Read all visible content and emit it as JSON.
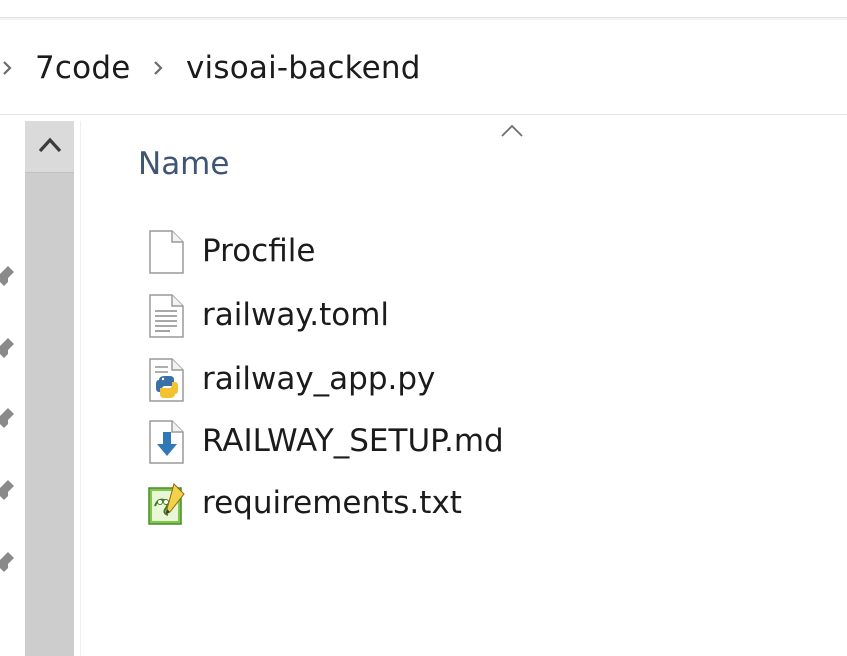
{
  "breadcrumb": {
    "items": [
      "7code",
      "visoai-backend"
    ]
  },
  "file_list": {
    "column_header": "Name",
    "sort_direction": "ascending",
    "files": [
      {
        "name": "Procfile",
        "icon": "blank-file-icon"
      },
      {
        "name": "railway.toml",
        "icon": "text-file-icon"
      },
      {
        "name": "railway_app.py",
        "icon": "python-file-icon"
      },
      {
        "name": "RAILWAY_SETUP.md",
        "icon": "markdown-download-file-icon"
      },
      {
        "name": "requirements.txt",
        "icon": "notepad-plus-plus-file-icon"
      }
    ]
  },
  "colors": {
    "header_text": "#3e5674",
    "text": "#1b1b1b",
    "scrollbar_track": "#cdcdcd",
    "pin_gray": "#8a8a8a"
  }
}
